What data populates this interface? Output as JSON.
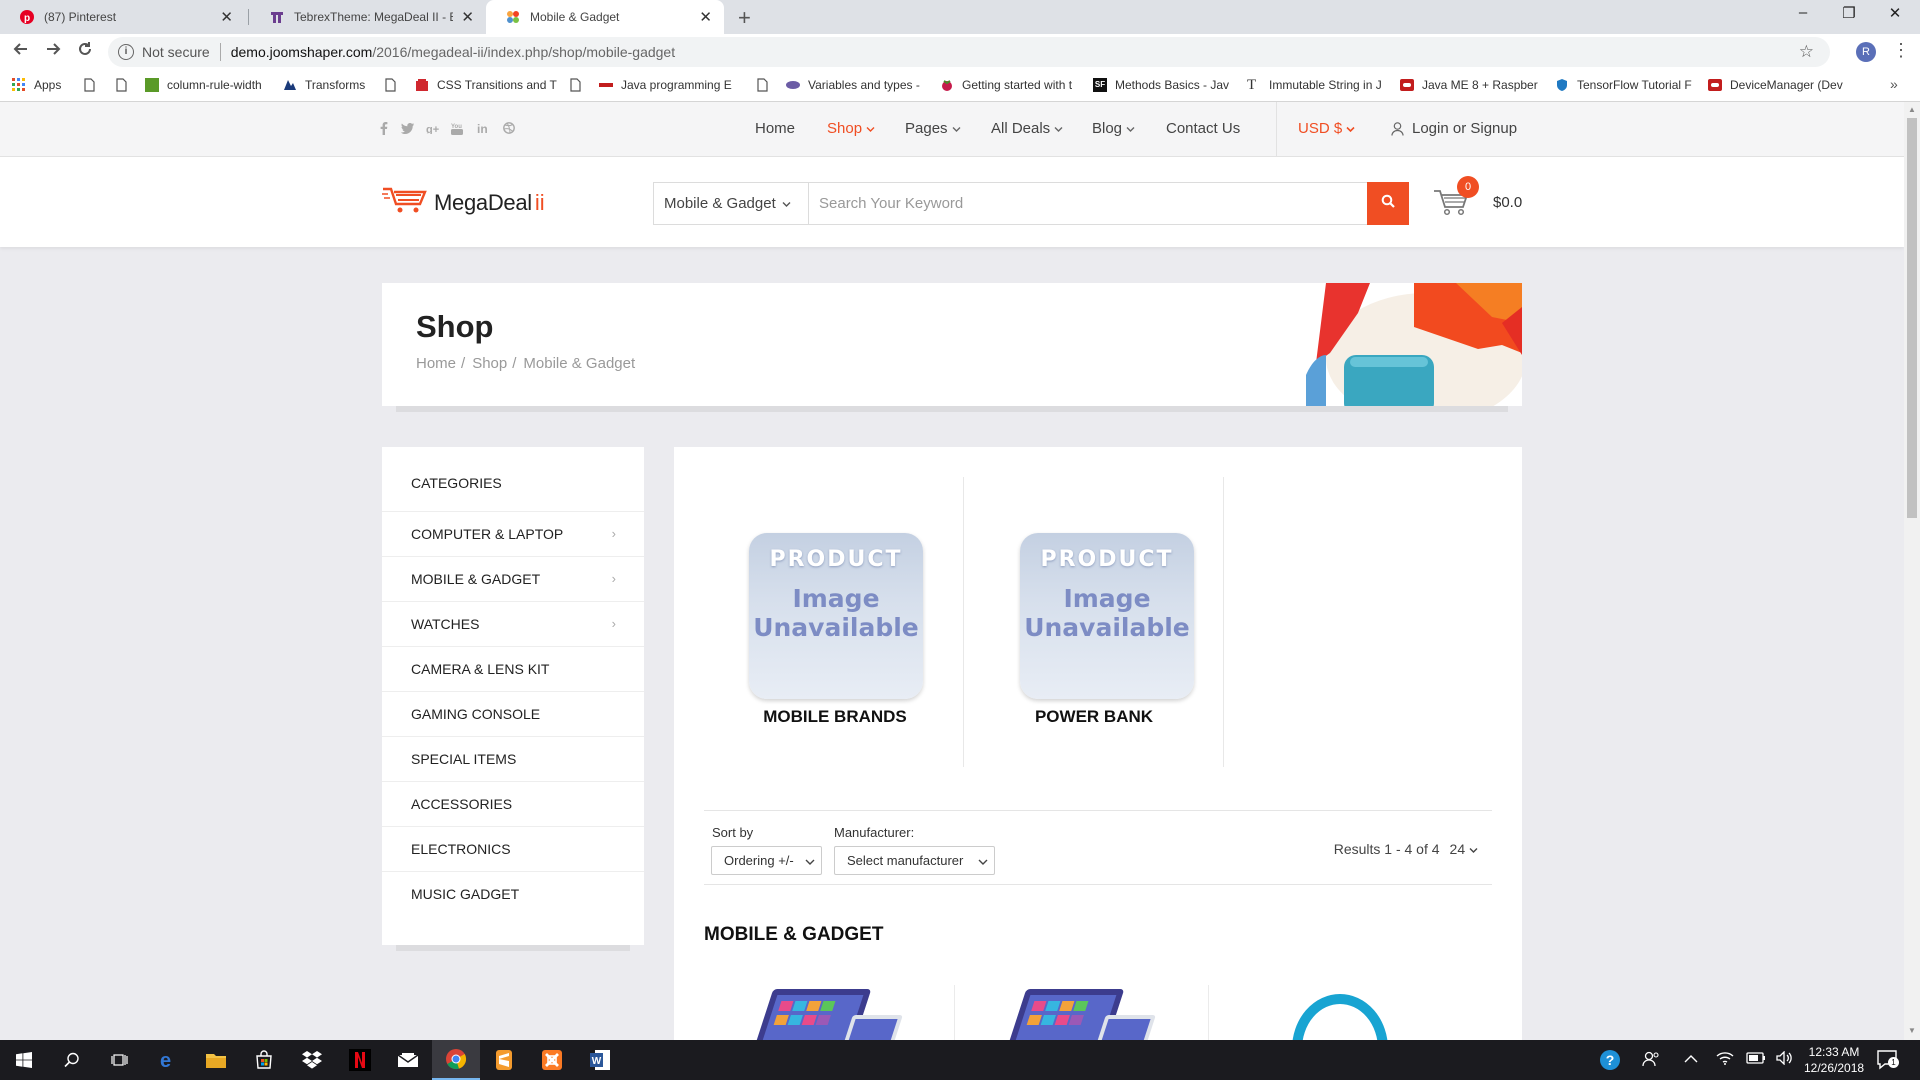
{
  "browser": {
    "tabs": [
      {
        "title": "(87) Pinterest",
        "icon": "pinterest-icon"
      },
      {
        "title": "TebrexTheme: MegaDeal II - Ecor",
        "icon": "tebrex-icon"
      },
      {
        "title": "Mobile & Gadget",
        "icon": "joomla-icon"
      }
    ],
    "window_controls": {
      "minimize": "–",
      "maximize": "❐",
      "close": "✕"
    },
    "address": {
      "not_secure": "Not secure",
      "host": "demo.joomshaper.com",
      "path": "/2016/megadeal-ii/index.php/shop/mobile-gadget"
    },
    "profile_initial": "R",
    "bookmarks": [
      {
        "label": "Apps"
      },
      {
        "label": ""
      },
      {
        "label": ""
      },
      {
        "label": "column-rule-width"
      },
      {
        "label": "Transforms"
      },
      {
        "label": ""
      },
      {
        "label": "CSS Transitions and T"
      },
      {
        "label": ""
      },
      {
        "label": "Java programming E"
      },
      {
        "label": ""
      },
      {
        "label": "Variables and types -"
      },
      {
        "label": "Getting started with t"
      },
      {
        "label": "Methods Basics - Jav"
      },
      {
        "label": "Immutable String in J"
      },
      {
        "label": "Java ME 8 + Raspber"
      },
      {
        "label": "TensorFlow Tutorial F"
      },
      {
        "label": "DeviceManager (Dev"
      }
    ],
    "more_bookmarks": "»"
  },
  "site": {
    "nav": [
      {
        "label": "Home"
      },
      {
        "label": "Shop"
      },
      {
        "label": "Pages"
      },
      {
        "label": "All Deals"
      },
      {
        "label": "Blog"
      },
      {
        "label": "Contact Us"
      }
    ],
    "currency": "USD $",
    "login": "Login or Signup",
    "logo": {
      "text": "MegaDeal",
      "suffix": "ii"
    },
    "search": {
      "category": "Mobile & Gadget",
      "placeholder": "Search Your Keyword"
    },
    "cart": {
      "count": "0",
      "total": "$0.0"
    },
    "page_title": "Shop",
    "breadcrumb": [
      "Home",
      "Shop",
      "Mobile & Gadget"
    ],
    "categories_heading": "CATEGORIES",
    "categories": [
      {
        "label": "COMPUTER & LAPTOP",
        "has_children": true
      },
      {
        "label": "MOBILE & GADGET",
        "has_children": true
      },
      {
        "label": "WATCHES",
        "has_children": true
      },
      {
        "label": "CAMERA & LENS KIT",
        "has_children": false
      },
      {
        "label": "GAMING CONSOLE",
        "has_children": false
      },
      {
        "label": "SPECIAL ITEMS",
        "has_children": false
      },
      {
        "label": "ACCESSORIES",
        "has_children": false
      },
      {
        "label": "ELECTRONICS",
        "has_children": false
      },
      {
        "label": "MUSIC GADGET",
        "has_children": false
      }
    ],
    "subcategories": [
      {
        "name": "MOBILE BRANDS",
        "image_text": [
          "PRODUCT",
          "Image",
          "Unavailable"
        ]
      },
      {
        "name": "POWER BANK",
        "image_text": [
          "PRODUCT",
          "Image",
          "Unavailable"
        ]
      }
    ],
    "filters": {
      "sort_label": "Sort by",
      "sort_value": "Ordering +/-",
      "manufacturer_label": "Manufacturer:",
      "manufacturer_value": "Select manufacturer",
      "results": "Results 1 - 4 of 4",
      "per_page": "24"
    },
    "section_title": "MOBILE & GADGET"
  },
  "taskbar": {
    "time": "12:33 AM",
    "date": "12/26/2018",
    "notifications": "1"
  },
  "colors": {
    "accent": "#f04e23",
    "page_bg": "#ebebef"
  }
}
